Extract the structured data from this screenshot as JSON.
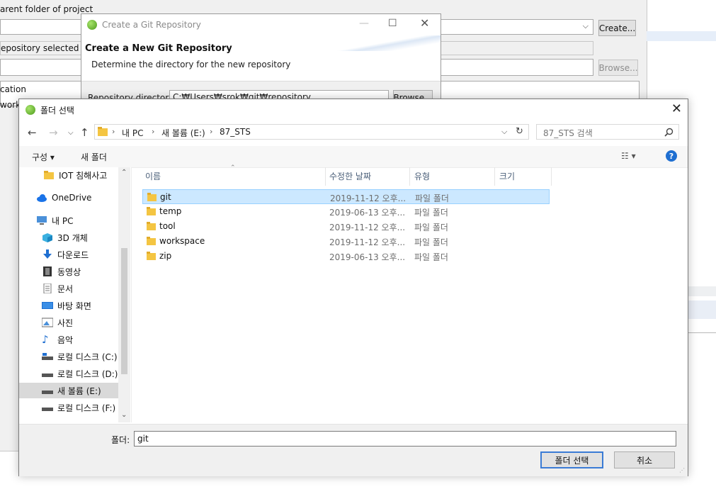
{
  "background_dialog": {
    "parent_folder_label": "arent folder of project",
    "create_button": "Create...",
    "repo_selected_text": "epository selected",
    "browse_button": "Browse...",
    "location_label": "cation",
    "work_label": "work"
  },
  "git_dialog": {
    "title": "Create a Git Repository",
    "heading": "Create a New Git Repository",
    "subtitle": "Determine the directory for the new repository",
    "repo_dir_label": "Repository directory:",
    "repo_dir_value": "C:₩Users₩srok₩git₩repository",
    "browse_button": "Browse..."
  },
  "folder_dialog": {
    "title": "폴더 선택",
    "breadcrumb": [
      "내 PC",
      "새 볼륨 (E:)",
      "87_STS"
    ],
    "search_placeholder": "87_STS 검색",
    "toolbar": {
      "organize": "구성 ▾",
      "new_folder": "새 폴더"
    },
    "nav_items": [
      {
        "label": "IOT 침해사고",
        "icon": "folder-icon"
      },
      {
        "label": "OneDrive",
        "icon": "cloud-icon"
      },
      {
        "label": "내 PC",
        "icon": "pc-icon"
      },
      {
        "label": "3D 개체",
        "icon": "cube-icon"
      },
      {
        "label": "다운로드",
        "icon": "download-icon"
      },
      {
        "label": "동영상",
        "icon": "video-icon"
      },
      {
        "label": "문서",
        "icon": "document-icon"
      },
      {
        "label": "바탕 화면",
        "icon": "desktop-icon"
      },
      {
        "label": "사진",
        "icon": "picture-icon"
      },
      {
        "label": "음악",
        "icon": "music-icon"
      },
      {
        "label": "로컬 디스크 (C:)",
        "icon": "drive-icon"
      },
      {
        "label": "로컬 디스크 (D:)",
        "icon": "drive-icon"
      },
      {
        "label": "새 볼륨 (E:)",
        "icon": "drive-icon",
        "selected": true
      },
      {
        "label": "로컬 디스크 (F:)",
        "icon": "drive-icon"
      }
    ],
    "columns": [
      "이름",
      "수정한 날짜",
      "유형",
      "크기"
    ],
    "files": [
      {
        "name": "git",
        "date": "2019-11-12 오후...",
        "type": "파일 폴더",
        "selected": true
      },
      {
        "name": "temp",
        "date": "2019-06-13 오후...",
        "type": "파일 폴더"
      },
      {
        "name": "tool",
        "date": "2019-11-12 오후...",
        "type": "파일 폴더"
      },
      {
        "name": "workspace",
        "date": "2019-11-12 오후...",
        "type": "파일 폴더"
      },
      {
        "name": "zip",
        "date": "2019-06-13 오후...",
        "type": "파일 폴더"
      }
    ],
    "folder_label": "폴더:",
    "folder_value": "git",
    "select_button": "폴더 선택",
    "cancel_button": "취소"
  },
  "colors": {
    "accent": "#3a7bd5",
    "selection": "#cce8ff",
    "folder": "#f4c542"
  }
}
